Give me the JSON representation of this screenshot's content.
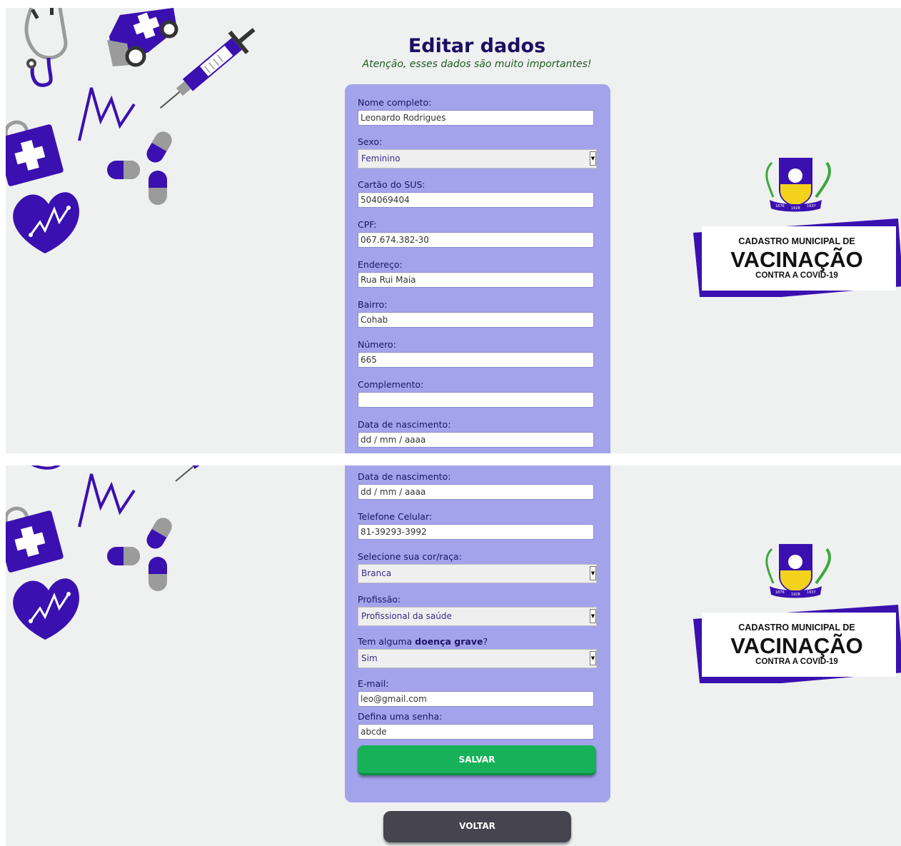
{
  "header": {
    "title": "Editar dados",
    "subtitle": "Atenção, esses dados são muito importantes!"
  },
  "form_top": {
    "nome": {
      "label": "Nome completo:",
      "value": "Leonardo Rodrigues"
    },
    "sexo": {
      "label": "Sexo:",
      "value": "Feminino"
    },
    "sus": {
      "label": "Cartão do SUS:",
      "value": "504069404"
    },
    "cpf": {
      "label": "CPF:",
      "value": "067.674.382-30"
    },
    "endereco": {
      "label": "Endereço:",
      "value": "Rua Rui Maia"
    },
    "bairro": {
      "label": "Bairro:",
      "value": "Cohab"
    },
    "numero": {
      "label": "Número:",
      "value": "665"
    },
    "complemento": {
      "label": "Complemento:",
      "value": ""
    },
    "nascimento": {
      "label": "Data de nascimento:",
      "value": "dd / mm / aaaa"
    }
  },
  "form_bottom": {
    "nascimento": {
      "label": "Data de nascimento:",
      "value": "dd / mm / aaaa"
    },
    "telefone": {
      "label": "Telefone Celular:",
      "value": "81-39293-3992"
    },
    "cor": {
      "label": "Selecione sua cor/raça:",
      "value": "Branca"
    },
    "profissao": {
      "label": "Profissão:",
      "value": "Profissional da saúde"
    },
    "doenca": {
      "label_pre": "Tem alguma ",
      "label_bold": "doença grave",
      "label_post": "?",
      "value": "Sim"
    },
    "email": {
      "label": "E-mail:",
      "value": "leo@gmail.com"
    },
    "senha": {
      "label": "Defina uma senha:",
      "value": "abcde"
    }
  },
  "buttons": {
    "save": "SALVAR",
    "back": "VOLTAR"
  },
  "logo": {
    "line1": "CADASTRO MUNICIPAL DE",
    "line2": "VACINAÇÃO",
    "line3": "CONTRA A COVID-19",
    "seal_year_left": "1876",
    "seal_year_center": "1928",
    "seal_year_right": "1937"
  },
  "icons": [
    "stethoscope-icon",
    "ambulance-icon",
    "syringe-icon",
    "heartbeat-line-icon",
    "medical-kit-icon",
    "pills-icon",
    "heart-pulse-icon"
  ],
  "colors": {
    "brand_purple": "#3a10b0",
    "title": "#1c0e63",
    "subtitle": "#1e5c1e",
    "card": "#a3a3ec",
    "save": "#16b158",
    "back": "#45444f",
    "background": "#eff0f0"
  }
}
